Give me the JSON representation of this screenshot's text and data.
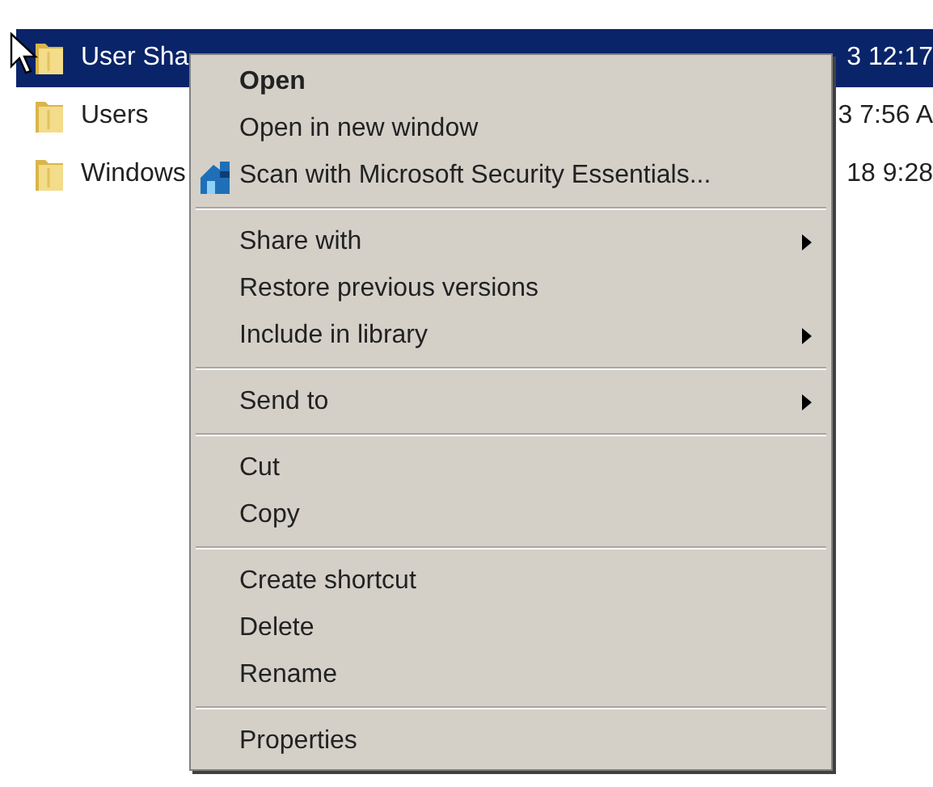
{
  "files": [
    {
      "name": "User Sha",
      "date": "3 12:17",
      "selected": true
    },
    {
      "name": "Users",
      "date": "3 7:56 A",
      "selected": false
    },
    {
      "name": "Windows",
      "date": "18 9:28",
      "selected": false
    }
  ],
  "context_menu": [
    {
      "kind": "default",
      "label": "Open"
    },
    {
      "kind": "item",
      "label": "Open in new window"
    },
    {
      "kind": "icon_item",
      "label": "Scan with Microsoft Security Essentials..."
    },
    {
      "kind": "separator"
    },
    {
      "kind": "submenu",
      "label": "Share with"
    },
    {
      "kind": "item",
      "label": "Restore previous versions"
    },
    {
      "kind": "submenu",
      "label": "Include in library"
    },
    {
      "kind": "separator"
    },
    {
      "kind": "submenu",
      "label": "Send to"
    },
    {
      "kind": "separator"
    },
    {
      "kind": "item",
      "label": "Cut"
    },
    {
      "kind": "item",
      "label": "Copy"
    },
    {
      "kind": "separator"
    },
    {
      "kind": "item",
      "label": "Create shortcut"
    },
    {
      "kind": "item",
      "label": "Delete"
    },
    {
      "kind": "item",
      "label": "Rename"
    },
    {
      "kind": "separator"
    },
    {
      "kind": "item",
      "label": "Properties"
    }
  ]
}
